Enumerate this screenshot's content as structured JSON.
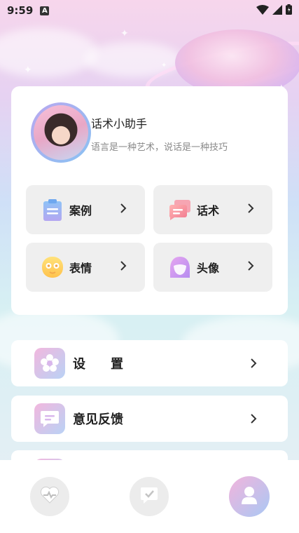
{
  "status_bar": {
    "time": "9:59",
    "notification_glyph": "A"
  },
  "profile": {
    "name": "话术小助手",
    "motto": "语言是一种艺术，说话是一种技巧"
  },
  "features": [
    {
      "label": "案例",
      "icon": "clipboard-icon"
    },
    {
      "label": "话术",
      "icon": "chat-bubbles-icon"
    },
    {
      "label": "表情",
      "icon": "emoji-face-icon"
    },
    {
      "label": "头像",
      "icon": "avatar-icon"
    }
  ],
  "menu": [
    {
      "label": "设　　置",
      "icon": "flower-settings-icon"
    },
    {
      "label": "意见反馈",
      "icon": "feedback-icon"
    }
  ],
  "bottom_nav": [
    {
      "name": "home",
      "icon": "heart-pulse-icon"
    },
    {
      "name": "tasks",
      "icon": "check-note-icon"
    },
    {
      "name": "profile",
      "icon": "user-icon",
      "active": true
    }
  ],
  "colors": {
    "accent_pink": "#f2b4dc",
    "accent_blue": "#a9c8f4",
    "card_bg": "#ffffff",
    "tile_bg": "#efefef"
  }
}
